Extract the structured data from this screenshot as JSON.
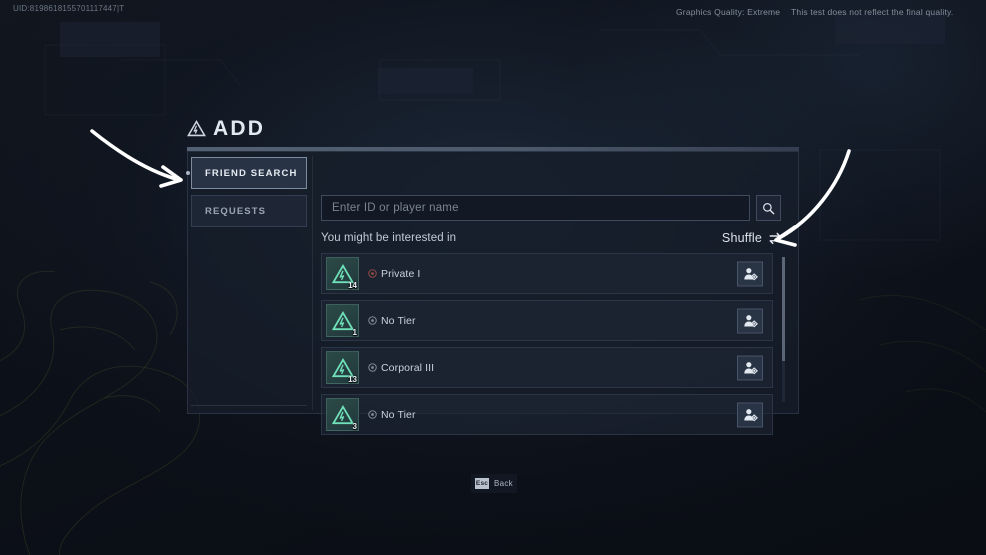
{
  "topbar": {
    "uid": "UID:8198618155701117447|T",
    "graphics_quality": "Graphics Quality: Extreme",
    "disclaimer": "This test does not reflect the final quality."
  },
  "modal": {
    "title": "ADD",
    "title_icon": "mountain-triangle-logo-icon"
  },
  "sidebar": {
    "items": [
      {
        "label": "FRIEND SEARCH",
        "active": true
      },
      {
        "label": "REQUESTS",
        "active": false
      }
    ]
  },
  "search": {
    "placeholder": "Enter ID or player name",
    "value": "",
    "search_icon": "magnifier-icon"
  },
  "suggestions": {
    "label": "You might be interested in",
    "shuffle_label": "Shuffle",
    "shuffle_icon": "swap-arrows-icon"
  },
  "players": [
    {
      "level": "14",
      "rank": "Private I",
      "rank_icon": "rank-badge-private-icon",
      "rank_color": "#8e4a43",
      "avatar_icon": "mountain-triangle-avatar-icon",
      "add_icon": "add-friend-icon"
    },
    {
      "level": "1",
      "rank": "No Tier",
      "rank_icon": "rank-badge-none-icon",
      "rank_color": "#7e8693",
      "avatar_icon": "mountain-triangle-avatar-icon",
      "add_icon": "add-friend-icon"
    },
    {
      "level": "13",
      "rank": "Corporal III",
      "rank_icon": "rank-badge-corporal-icon",
      "rank_color": "#7e8693",
      "avatar_icon": "mountain-triangle-avatar-icon",
      "add_icon": "add-friend-icon"
    },
    {
      "level": "3",
      "rank": "No Tier",
      "rank_icon": "rank-badge-none-icon",
      "rank_color": "#7e8693",
      "avatar_icon": "mountain-triangle-avatar-icon",
      "add_icon": "add-friend-icon"
    }
  ],
  "footer": {
    "key": "Esc",
    "action": "Back"
  },
  "annotations": {
    "arrow_left": "arrow-pointing-to-friend-search",
    "arrow_right": "arrow-pointing-to-add-friend-button"
  },
  "colors": {
    "accent": "#8fe0c8",
    "panel_bg": "#171e2b",
    "text_primary": "#e2e8ef",
    "text_muted": "#7b8592"
  }
}
